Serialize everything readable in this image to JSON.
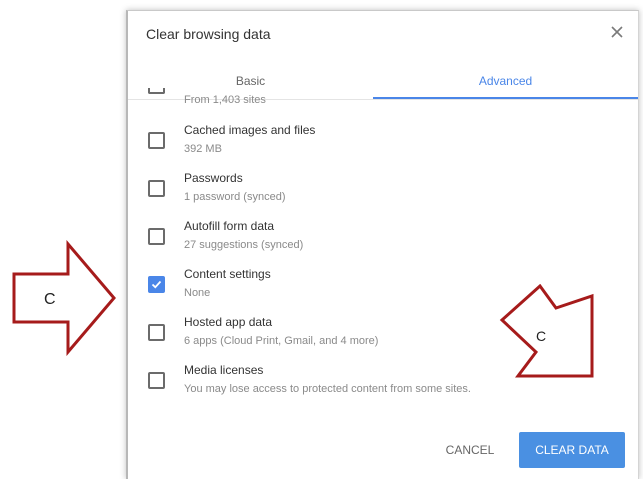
{
  "dialog": {
    "title": "Clear browsing data",
    "close_icon": "close-icon",
    "tabs": [
      {
        "label": "Basic"
      },
      {
        "label": "Advanced"
      }
    ],
    "items": [
      {
        "label": "",
        "sublabel": "From 1,403 sites",
        "checked": false
      },
      {
        "label": "Cached images and files",
        "sublabel": "392 MB",
        "checked": false
      },
      {
        "label": "Passwords",
        "sublabel": "1 password (synced)",
        "checked": false
      },
      {
        "label": "Autofill form data",
        "sublabel": "27 suggestions (synced)",
        "checked": false
      },
      {
        "label": "Content settings",
        "sublabel": "None",
        "checked": true
      },
      {
        "label": "Hosted app data",
        "sublabel": "6 apps (Cloud Print, Gmail, and 4 more)",
        "checked": false
      },
      {
        "label": "Media licenses",
        "sublabel": "You may lose access to protected content from some sites.",
        "checked": false
      }
    ],
    "cancel_label": "CANCEL",
    "clear_label": "CLEAR DATA"
  },
  "annotations": {
    "left_arrow_letter": "C",
    "right_arrow_letter": "C",
    "arrow_color": "#a61b1b"
  },
  "colors": {
    "accent": "#4a86e8",
    "button": "#4a90e2"
  }
}
